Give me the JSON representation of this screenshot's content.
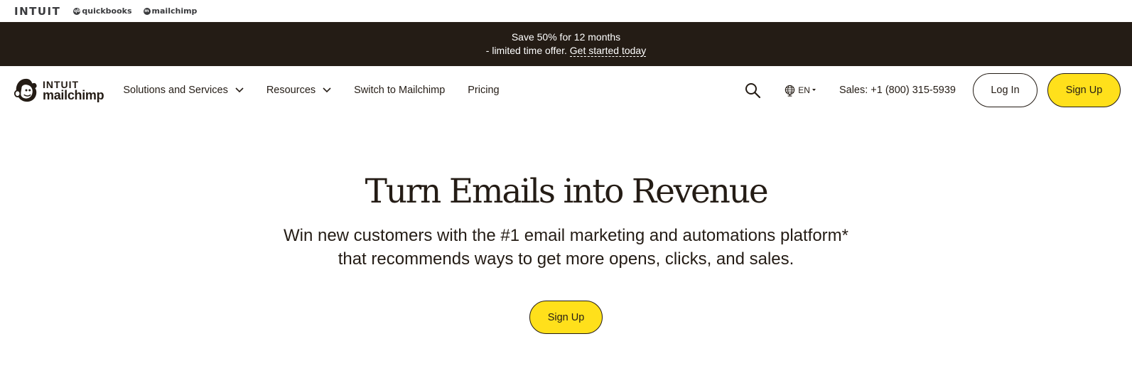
{
  "family_bar": {
    "intuit": "INTUIT",
    "quickbooks": "quickbooks",
    "mailchimp": "mailchimp"
  },
  "promo": {
    "line1": "Save 50% for 12 months",
    "line2_prefix": "- limited time offer.",
    "link": "Get started today"
  },
  "nav": {
    "logo_top": "INTUIT",
    "logo_bottom": "mailchimp",
    "items": [
      {
        "label": "Solutions and Services",
        "icon": "chevron-down-icon"
      },
      {
        "label": "Resources",
        "icon": "chevron-down-icon"
      },
      {
        "label": "Switch to Mailchimp"
      },
      {
        "label": "Pricing"
      }
    ],
    "search_icon": "search-icon",
    "language": "EN",
    "sales": "Sales: +1 (800) 315-5939",
    "login": "Log In",
    "signup": "Sign Up"
  },
  "hero": {
    "title": "Turn Emails into Revenue",
    "subtitle_line1": "Win new customers with the #1 email marketing and automations platform*",
    "subtitle_line2": "that recommends ways to get more opens, clicks, and sales.",
    "cta": "Sign Up"
  },
  "colors": {
    "banner_bg": "#241c15",
    "accent_yellow": "#ffe01b",
    "text": "#241c15"
  }
}
